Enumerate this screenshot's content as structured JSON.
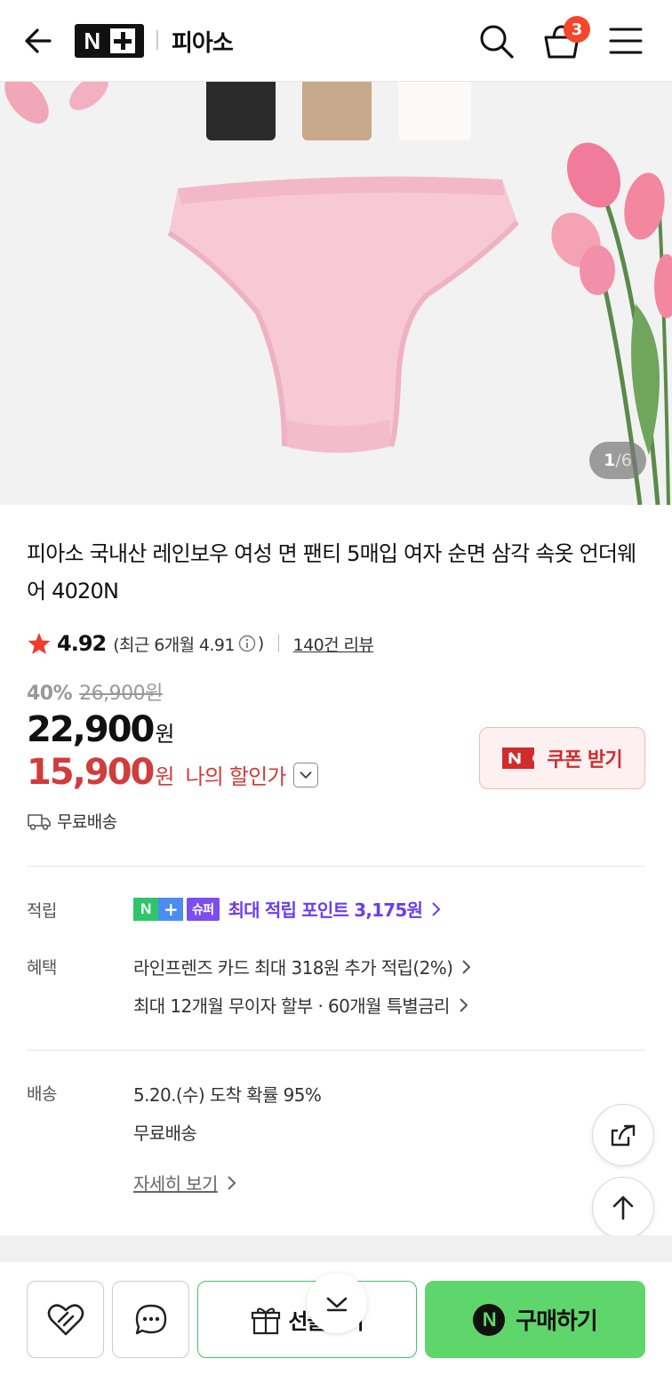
{
  "header": {
    "logo_n": "N",
    "brand": "피아소",
    "cart_count": "3"
  },
  "gallery": {
    "current": "1",
    "sep": "/",
    "total": "6"
  },
  "product": {
    "title": "피아소 국내산 레인보우 여성 면 팬티 5매입 여자 순면 삼각 속옷 언더웨어 4020N",
    "rating": "4.92",
    "recent_prefix": "(최근 6개월 4.91",
    "recent_suffix": ")",
    "review_count": "140건 리뷰",
    "discount_rate": "40%",
    "original_price": "26,900원",
    "sale_price": "22,900",
    "price_unit": "원",
    "my_price": "15,900",
    "my_unit": "원",
    "my_label": "나의 할인가",
    "coupon_label": "쿠폰 받기",
    "free_shipping": "무료배송"
  },
  "points": {
    "label": "적립",
    "badge_n": "N",
    "badge_plus": "+",
    "badge_super": "슈퍼",
    "text": "최대 적립 포인트 3,175원"
  },
  "benefits": {
    "label": "혜택",
    "items": [
      "라인프렌즈 카드 최대 318원 추가 적립(2%)",
      "최대 12개월 무이자 할부 · 60개월 특별금리"
    ]
  },
  "delivery": {
    "label": "배송",
    "arrival": "5.20.(수) 도착 확률 95%",
    "fee": "무료배송",
    "detail_link": "자세히 보기"
  },
  "bottom": {
    "gift_label": "선물하기",
    "buy_n": "N",
    "buy_label": "구매하기"
  },
  "colors": {
    "accent_green": "#5fd66b",
    "discount_red": "#d13c3c",
    "points_purple": "#6a3df0",
    "badge_orange": "#f5462b"
  },
  "icons": [
    "back-arrow-icon",
    "search-icon",
    "shopping-bag-icon",
    "hamburger-menu-icon",
    "star-icon",
    "info-icon",
    "chevron-down-icon",
    "truck-icon",
    "chevron-right-icon",
    "share-icon",
    "arrow-up-icon",
    "heart-icon",
    "chat-icon",
    "gift-icon"
  ]
}
